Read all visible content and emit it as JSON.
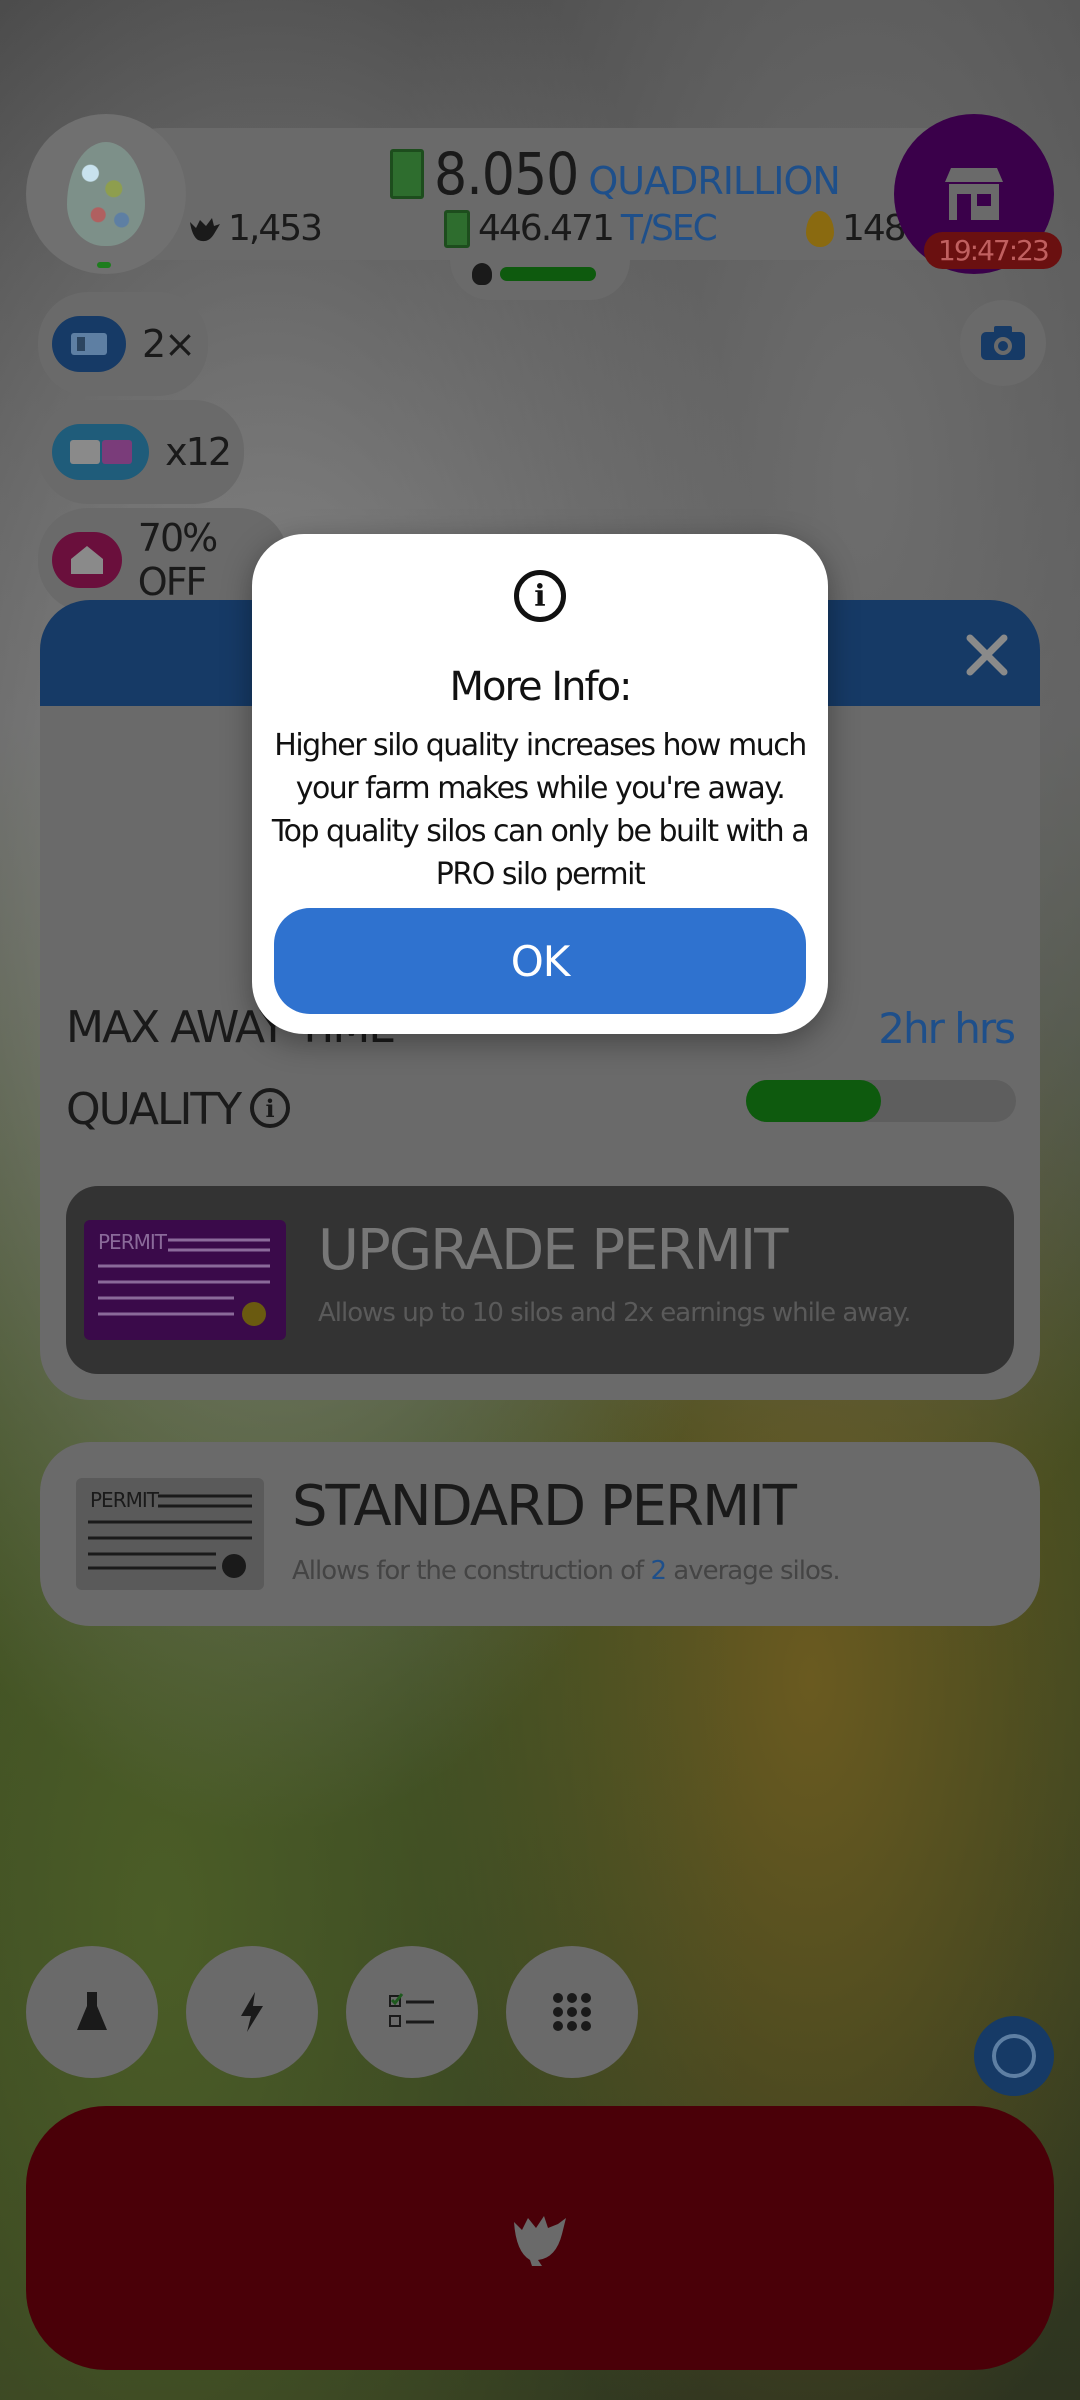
{
  "header": {
    "money_value": "8.050",
    "money_unit": "QUADRILLION",
    "chicken_count": "1,453",
    "earning_rate": "446.471",
    "earning_rate_unit": "T/SEC",
    "golden_eggs": "148",
    "shop_timer": "19:47:23",
    "shop_color": "#3a004a"
  },
  "left_buttons": [
    {
      "label": "2×",
      "icon": "video-boost-icon",
      "color": "#163a66"
    },
    {
      "label": "x12",
      "icon": "boost-cards-icon",
      "color": "#1f5c7a"
    },
    {
      "label": "70% OFF",
      "icon": "house-sale-icon",
      "color": "#6a0f3c"
    }
  ],
  "silo_panel": {
    "max_away_label": "MAX AWAY TIME",
    "max_away_value": "2hr hrs",
    "quality_label": "QUALITY",
    "quality_level": 0.5,
    "upgrade_permit": {
      "badge": "PERMIT",
      "title": "UPGRADE PERMIT",
      "description": "Allows up to 10 silos and 2x earnings while away."
    }
  },
  "standard_permit": {
    "badge": "PERMIT",
    "title": "STANDARD PERMIT",
    "description_prefix": "Allows for the construction of",
    "description_count": "2",
    "description_suffix": "average silos."
  },
  "bottom_nav": [
    "research-flask-icon",
    "boost-lightning-icon",
    "checklist-icon",
    "grid-menu-icon"
  ],
  "dialog": {
    "title": "More Info:",
    "body": "Higher silo quality increases how much your farm makes while you're away. Top quality silos can only be built with a PRO silo permit",
    "ok_label": "OK"
  },
  "colors": {
    "accent_blue": "#2f72cf",
    "hatch_button": "#4a0008",
    "progress_green": "#0e5a0e"
  }
}
